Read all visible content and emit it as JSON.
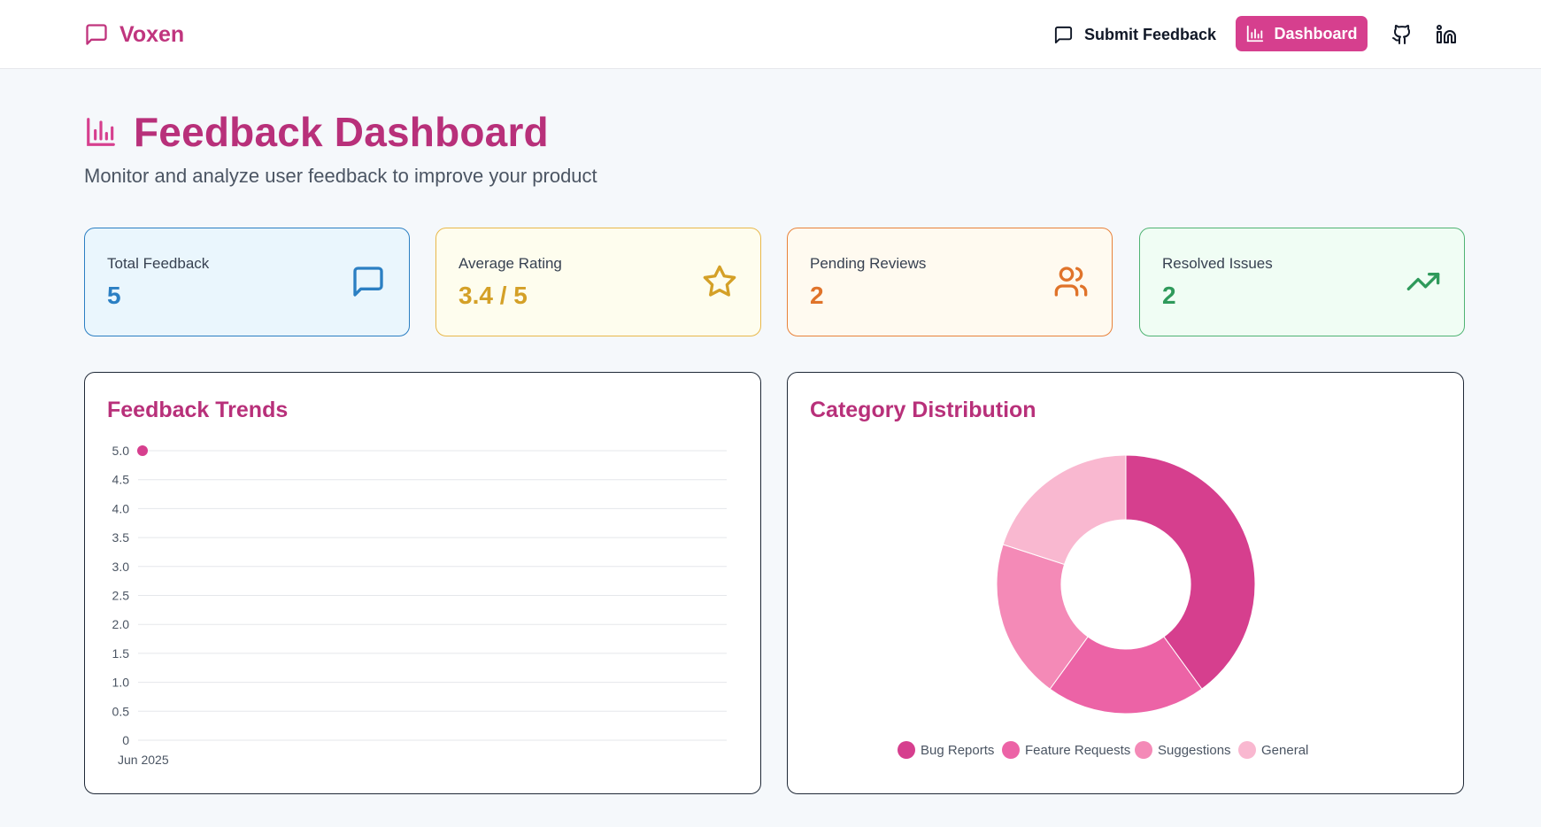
{
  "nav": {
    "brand": "Voxen",
    "submit_label": "Submit Feedback",
    "dashboard_label": "Dashboard"
  },
  "header": {
    "title": "Feedback Dashboard",
    "subtitle": "Monitor and analyze user feedback to improve your product"
  },
  "stats": [
    {
      "label": "Total Feedback",
      "value": "5",
      "icon": "message-icon",
      "color": "#2b7fc3",
      "bg": "#eaf6fd",
      "border": "#2b7fc3"
    },
    {
      "label": "Average Rating",
      "value": "3.4 / 5",
      "icon": "star-icon",
      "color": "#d4a027",
      "bg": "#fefdee",
      "border": "#e8b84a"
    },
    {
      "label": "Pending Reviews",
      "value": "2",
      "icon": "users-icon",
      "color": "#e0732a",
      "bg": "#fffaf0",
      "border": "#e8823a"
    },
    {
      "label": "Resolved Issues",
      "value": "2",
      "icon": "trending-up-icon",
      "color": "#2f9a5b",
      "bg": "#f0fdf4",
      "border": "#4fb373"
    }
  ],
  "colors": {
    "accent": "#d63f8e",
    "title": "#b8307a"
  },
  "charts": {
    "trends_title": "Feedback Trends",
    "category_title": "Category Distribution"
  },
  "chart_data": [
    {
      "type": "line",
      "title": "Feedback Trends",
      "x": [
        "Jun 2025"
      ],
      "series": [
        {
          "values": [
            5.0
          ]
        }
      ],
      "ylim": [
        0,
        5
      ],
      "yticks": [
        "0",
        "0.5",
        "1.0",
        "1.5",
        "2.0",
        "2.5",
        "3.0",
        "3.5",
        "4.0",
        "4.5",
        "5.0"
      ],
      "grid": true,
      "color": "#d63f8e"
    },
    {
      "type": "pie",
      "title": "Category Distribution",
      "categories": [
        "Bug Reports",
        "Feature Requests",
        "Suggestions",
        "General"
      ],
      "values": [
        2,
        1,
        1,
        1
      ],
      "colors": [
        "#d63f8e",
        "#ec63a6",
        "#f48ab7",
        "#f9b8d0"
      ],
      "legend": "bottom"
    }
  ]
}
